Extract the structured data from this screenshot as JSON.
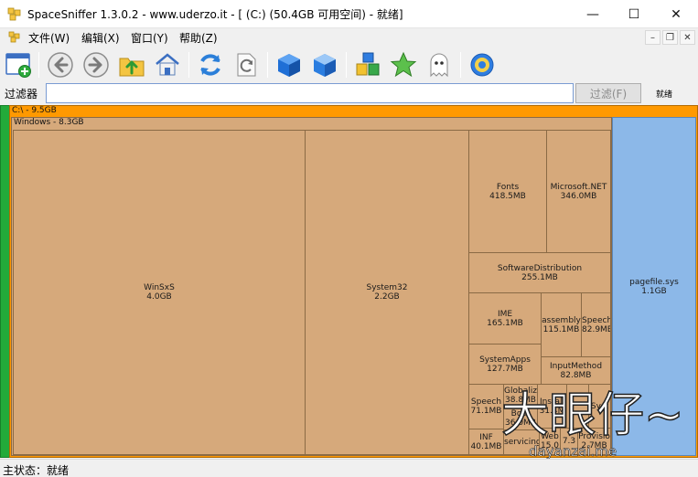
{
  "window": {
    "title": "SpaceSniffer 1.3.0.2 - www.uderzo.it - [ (C:) (50.4GB 可用空间) - 就绪]",
    "minimize_glyph": "—",
    "maximize_glyph": "☐",
    "close_glyph": "✕"
  },
  "menu": {
    "file": "文件(W)",
    "edit": "编辑(X)",
    "window": "窗口(Y)",
    "help": "帮助(Z)",
    "mdi_minimize": "–",
    "mdi_restore": "❐",
    "mdi_close": "✕"
  },
  "toolbar": {
    "icons": [
      "new-scan-icon",
      "back-icon",
      "forward-icon",
      "up-folder-icon",
      "home-icon",
      "refresh-icon",
      "refresh-document-icon",
      "blue-box-icon",
      "blue-box-alt-icon",
      "colored-cubes-icon",
      "star-icon",
      "ghost-icon",
      "settings-gear-icon"
    ]
  },
  "filter": {
    "label": "过滤器",
    "value": "",
    "placeholder": "",
    "button_label": "过滤(F)",
    "status": "就绪"
  },
  "treemap": {
    "drive": "C:\\ - 9.5GB",
    "windows_folder": "Windows - 8.3GB",
    "blocks": {
      "winsxs": {
        "name": "WinSxS",
        "size": "4.0GB"
      },
      "system32": {
        "name": "System32",
        "size": "2.2GB"
      },
      "fonts": {
        "name": "Fonts",
        "size": "418.5MB"
      },
      "microsoft_net": {
        "name": "Microsoft.NET",
        "size": "346.0MB"
      },
      "software_distribution": {
        "name": "SoftwareDistribution",
        "size": "255.1MB"
      },
      "ime": {
        "name": "IME",
        "size": "165.1MB"
      },
      "assembly": {
        "name": "assembly",
        "size": "115.1MB"
      },
      "speech_a": {
        "name": "Speech",
        "size": "82.9MB"
      },
      "system_apps": {
        "name": "SystemApps",
        "size": "127.7MB"
      },
      "input_method": {
        "name": "InputMethod",
        "size": "82.8MB"
      },
      "speech_b": {
        "name": "Speech",
        "size": "71.1MB"
      },
      "globaliz": {
        "name": "Globaliz",
        "size": "38.8MB"
      },
      "boot": {
        "name": "Boot",
        "size": "36.0MB"
      },
      "install": {
        "name": "Install",
        "size": "31.4M"
      },
      "inf": {
        "name": "INF",
        "size": "40.1MB"
      },
      "servicing": {
        "name": "servicing",
        "size": ""
      },
      "web": {
        "name": "Web",
        "size": "15.0"
      },
      "small_7": {
        "name": "",
        "size": "7.3"
      },
      "provisio": {
        "name": "Provisio",
        "size": "2.7MB"
      },
      "syst": {
        "name": "Syst",
        "size": ""
      },
      "pagefile": {
        "name": "pagefile.sys",
        "size": "1.1GB"
      }
    }
  },
  "colors": {
    "folder_tan": "#d6a97b",
    "drive_orange": "#ff9900",
    "file_blue": "#8cb8e8",
    "free_green": "#22aa3a"
  },
  "status": {
    "text": "主状态：就绪"
  },
  "watermark": {
    "line1": "大眼仔~旭",
    "line2": "dayanzai.me"
  }
}
